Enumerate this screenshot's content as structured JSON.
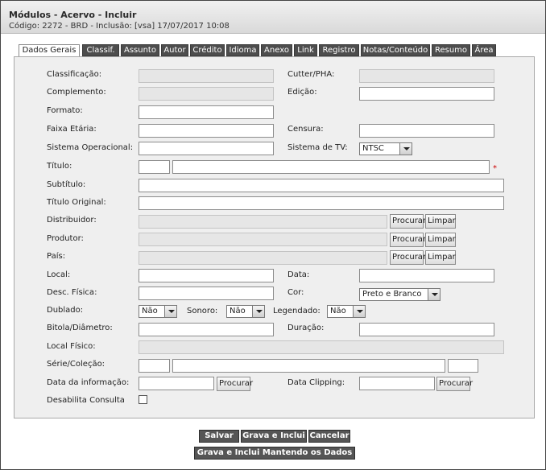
{
  "window": {
    "title": "Módulos - Acervo - Incluir",
    "subtitle": "Código: 2272 - BRD - Inclusão: [vsa] 17/07/2017 10:08"
  },
  "tabs": [
    {
      "label": "Dados Gerais"
    },
    {
      "label": "Classif."
    },
    {
      "label": "Assunto"
    },
    {
      "label": "Autor"
    },
    {
      "label": "Crédito"
    },
    {
      "label": "Idioma"
    },
    {
      "label": "Anexo"
    },
    {
      "label": "Link"
    },
    {
      "label": "Registro"
    },
    {
      "label": "Notas/Conteúdo"
    },
    {
      "label": "Resumo"
    },
    {
      "label": "Área"
    }
  ],
  "form": {
    "classificacao": "Classificação:",
    "cutter": "Cutter/PHA:",
    "complemento": "Complemento:",
    "edicao": "Edição:",
    "formato": "Formato:",
    "faixa_etaria": "Faixa Etária:",
    "censura": "Censura:",
    "sistema_operacional": "Sistema Operacional:",
    "sistema_tv": "Sistema de TV:",
    "sistema_tv_value": "NTSC",
    "titulo": "Título:",
    "subtitulo": "Subtítulo:",
    "titulo_original": "Título Original:",
    "distribuidor": "Distribuidor:",
    "produtor": "Produtor:",
    "pais": "País:",
    "local": "Local:",
    "data": "Data:",
    "desc_fisica": "Desc. Física:",
    "cor": "Cor:",
    "cor_value": "Preto e Branco",
    "dublado": "Dublado:",
    "dublado_value": "Não",
    "sonoro": "Sonoro:",
    "sonoro_value": "Não",
    "legendado": "Legendado:",
    "legendado_value": "Não",
    "bitola": "Bitola/Diâmetro:",
    "duracao": "Duração:",
    "local_fisico": "Local Físico:",
    "serie": "Série/Coleção:",
    "data_informacao": "Data da informação:",
    "data_clipping": "Data Clipping:",
    "desabilita": "Desabilita Consulta",
    "required_mark": "*",
    "procurar": "Procurar",
    "limpar": "Limpar"
  },
  "actions": {
    "salvar": "Salvar",
    "grava_inclui": "Grava e Inclui",
    "cancelar": "Cancelar",
    "grava_mantendo": "Grava e Inclui Mantendo os Dados"
  }
}
